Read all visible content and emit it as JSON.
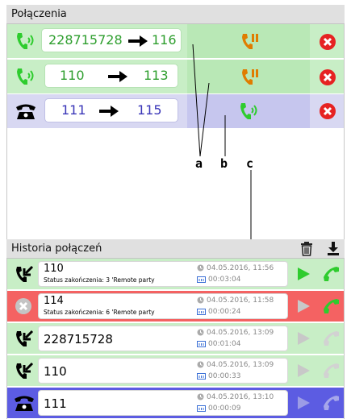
{
  "connections": {
    "title": "Połączenia",
    "rows": [
      {
        "from": "228715728",
        "to": "116",
        "state": "active"
      },
      {
        "from": "110",
        "to": "113",
        "state": "active"
      },
      {
        "from": "111",
        "to": "115",
        "state": "ringing"
      }
    ]
  },
  "annotations": {
    "a": "a",
    "b": "b",
    "c": "c"
  },
  "history": {
    "title": "Historia połączeń",
    "rows": [
      {
        "number": "110",
        "status": "Status zakończenia: 3 'Remote party",
        "date": "04.05.2016, 11:56",
        "duration": "00:03:04"
      },
      {
        "number": "114",
        "status": "Status zakończenia: 6 'Remote party",
        "date": "04.05.2016, 11:58",
        "duration": "00:00:24"
      },
      {
        "number": "228715728",
        "status": "",
        "date": "04.05.2016, 13:09",
        "duration": "00:01:04"
      },
      {
        "number": "110",
        "status": "",
        "date": "04.05.2016, 13:09",
        "duration": "00:00:33"
      },
      {
        "number": "111",
        "status": "",
        "date": "04.05.2016, 13:10",
        "duration": "00:00:09"
      }
    ]
  },
  "colors": {
    "green": "#2ecc2e",
    "orange": "#e07c00",
    "red": "#e62222",
    "blue": "#3a36b8"
  }
}
